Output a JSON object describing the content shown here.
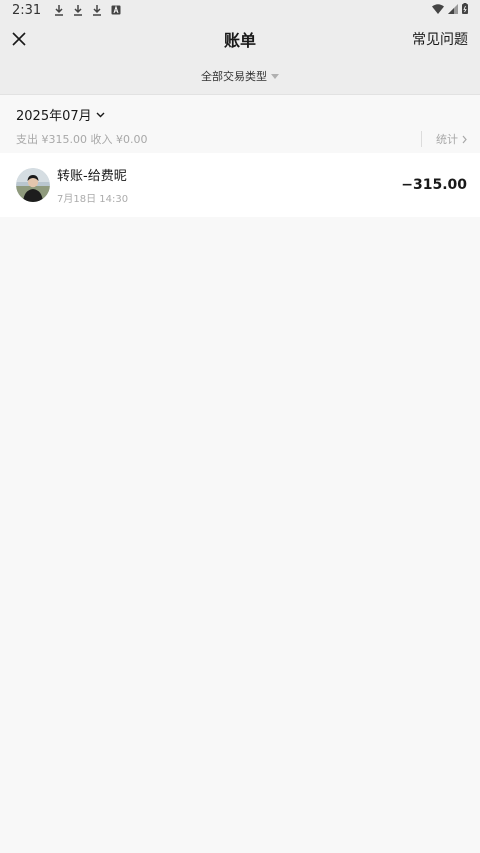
{
  "status_bar": {
    "time": "2:31",
    "notification_icons": [
      "download-icon",
      "download-icon",
      "download-icon",
      "translate-icon"
    ],
    "system_icons": [
      "wifi-icon",
      "signal-icon",
      "battery-icon"
    ]
  },
  "nav": {
    "title": "账单",
    "faq_label": "常见问题",
    "close_icon": "close-icon"
  },
  "filter": {
    "label": "全部交易类型"
  },
  "month": {
    "label": "2025年07月",
    "summary": "支出 ¥315.00 收入 ¥0.00",
    "stats_label": "统计"
  },
  "transactions": [
    {
      "title": "转账-给费昵",
      "time": "7月18日 14:30",
      "amount": "−315.00"
    }
  ],
  "colors": {
    "header_bg": "#ededed",
    "page_bg": "#f8f8f8",
    "text": "#191919",
    "muted": "#a8a8a8"
  }
}
